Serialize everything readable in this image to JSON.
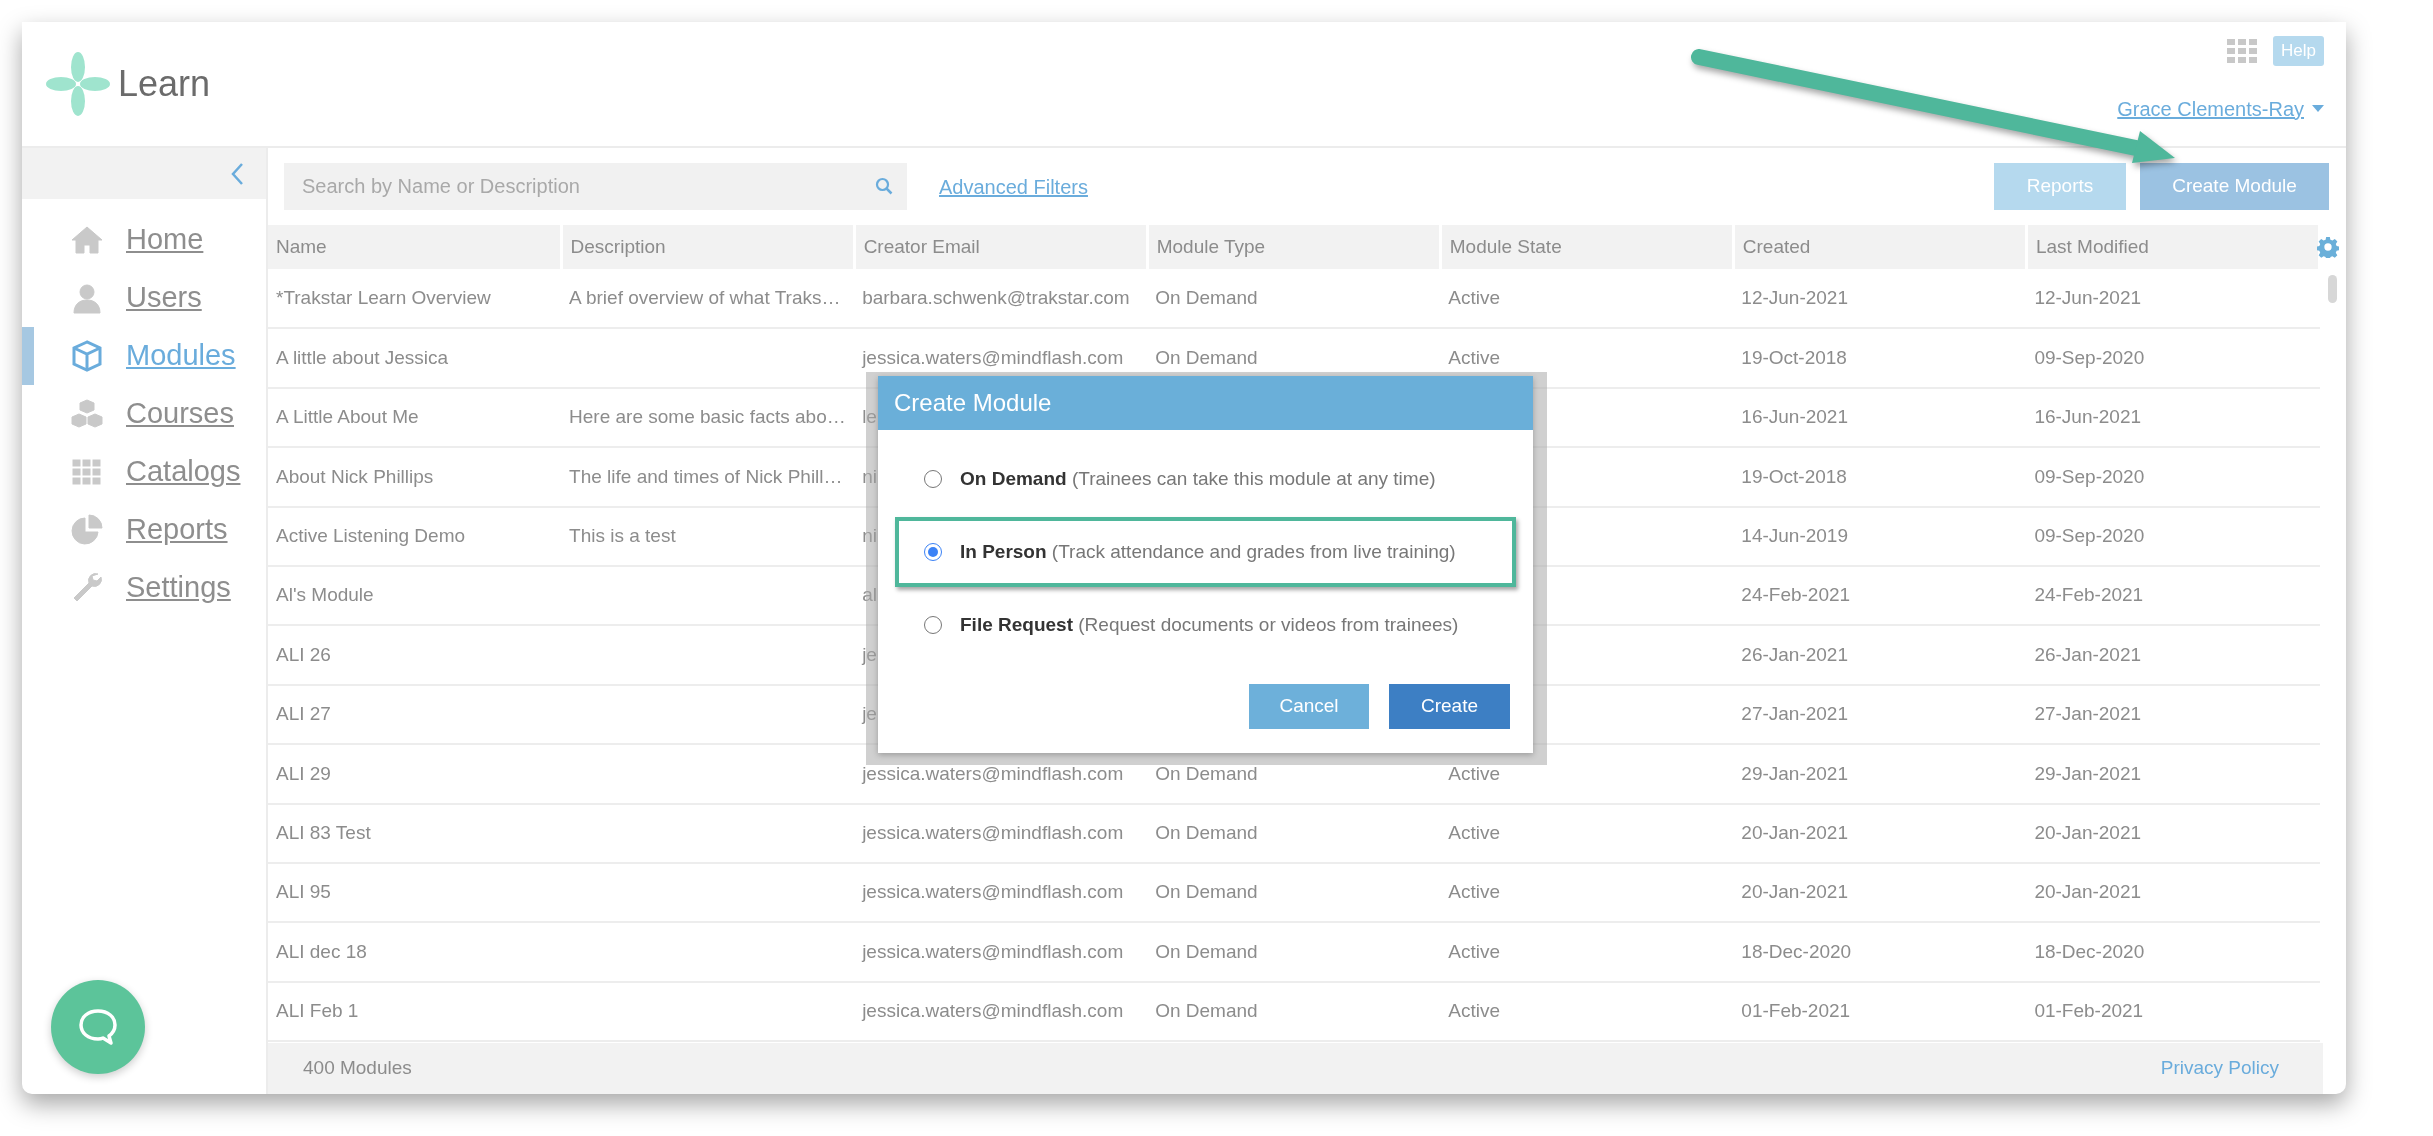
{
  "header": {
    "logo_text": "Learn",
    "help": "Help",
    "user_name": "Grace Clements-Ray"
  },
  "sidebar": {
    "items": [
      {
        "label": "Home",
        "selected": false
      },
      {
        "label": "Users",
        "selected": false
      },
      {
        "label": "Modules",
        "selected": true
      },
      {
        "label": "Courses",
        "selected": false
      },
      {
        "label": "Catalogs",
        "selected": false
      },
      {
        "label": "Reports",
        "selected": false
      },
      {
        "label": "Settings",
        "selected": false
      }
    ]
  },
  "toolbar": {
    "search": {
      "placeholder": "Search by Name or Description"
    },
    "advanced_filters": "Advanced Filters",
    "buttons": [
      "Reports",
      "Create Module"
    ]
  },
  "table": {
    "columns": [
      "Name",
      "Description",
      "Creator Email",
      "Module Type",
      "Module State",
      "Created",
      "Last Modified"
    ],
    "rows": [
      {
        "name": "*Trakstar Learn Overview",
        "description": "A brief overview of what Traks…",
        "creator_email": "barbara.schwenk@trakstar.com",
        "module_type": "On Demand",
        "module_state": "Active",
        "created": "12-Jun-2021",
        "last_modified": "12-Jun-2021"
      },
      {
        "name": "A little about Jessica",
        "creator_email": "jessica.waters@mindflash.com",
        "module_type": "On Demand",
        "module_state": "Active",
        "created": "19-Oct-2018",
        "last_modified": "09-Sep-2020"
      },
      {
        "name": "A Little About Me",
        "description": "Here are some basic facts abo…",
        "creator_email": "le",
        "created": "16-Jun-2021",
        "last_modified": "16-Jun-2021"
      },
      {
        "name": "About Nick Phillips",
        "description": "The life and times of Nick Phill…",
        "creator_email": "ni",
        "created": "19-Oct-2018",
        "last_modified": "09-Sep-2020"
      },
      {
        "name": "Active Listening Demo",
        "description": "This is a test",
        "creator_email": "ni",
        "created": "14-Jun-2019",
        "last_modified": "09-Sep-2020"
      },
      {
        "name": "Al's Module",
        "creator_email": "al",
        "created": "24-Feb-2021",
        "last_modified": "24-Feb-2021"
      },
      {
        "name": "ALI 26",
        "creator_email": "je",
        "created": "26-Jan-2021",
        "last_modified": "26-Jan-2021"
      },
      {
        "name": "ALI 27",
        "creator_email": "je",
        "created": "27-Jan-2021",
        "last_modified": "27-Jan-2021"
      },
      {
        "name": "ALI 29",
        "creator_email": "jessica.waters@mindflash.com",
        "module_type": "On Demand",
        "module_state": "Active",
        "created": "29-Jan-2021",
        "last_modified": "29-Jan-2021"
      },
      {
        "name": "ALI 83 Test",
        "creator_email": "jessica.waters@mindflash.com",
        "module_type": "On Demand",
        "module_state": "Active",
        "created": "20-Jan-2021",
        "last_modified": "20-Jan-2021"
      },
      {
        "name": "ALI 95",
        "creator_email": "jessica.waters@mindflash.com",
        "module_type": "On Demand",
        "module_state": "Active",
        "created": "20-Jan-2021",
        "last_modified": "20-Jan-2021"
      },
      {
        "name": "ALI dec 18",
        "creator_email": "jessica.waters@mindflash.com",
        "module_type": "On Demand",
        "module_state": "Active",
        "created": "18-Dec-2020",
        "last_modified": "18-Dec-2020"
      },
      {
        "name": "ALI Feb 1",
        "creator_email": "jessica.waters@mindflash.com",
        "module_type": "On Demand",
        "module_state": "Active",
        "created": "01-Feb-2021",
        "last_modified": "01-Feb-2021"
      }
    ]
  },
  "footer": {
    "count": "400 Modules",
    "privacy_link": "Privacy Policy"
  },
  "dialog": {
    "title": "Create Module",
    "options": [
      {
        "label": "**On Demand** (Trainees can take this module at any time)",
        "selected": false,
        "highlighted": false
      },
      {
        "label": "**In Person** (Track attendance and grades from live training)",
        "selected": true,
        "highlighted": true
      },
      {
        "label": "**File Request** (Request documents or videos from trainees)",
        "selected": false,
        "highlighted": false
      }
    ],
    "buttons": [
      "Cancel",
      "Create"
    ]
  }
}
